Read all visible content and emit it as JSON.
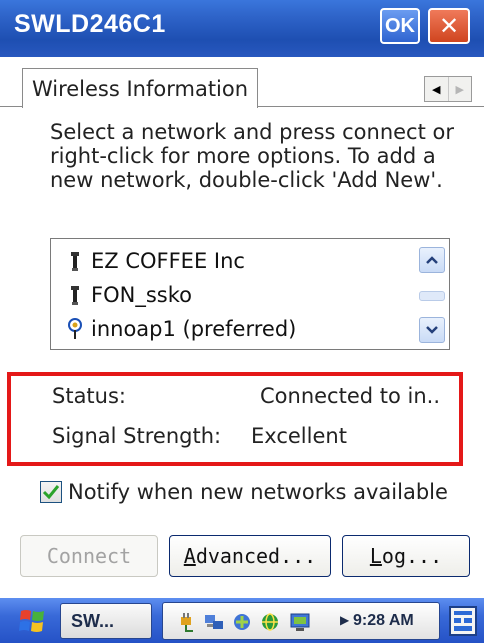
{
  "window": {
    "title": "SWLD246C1",
    "ok_label": "OK",
    "close_label": "✕"
  },
  "tabs": [
    {
      "label": "Wireless Information",
      "selected": true
    }
  ],
  "tab_scroll": {
    "left_icon": "chevron-left-icon",
    "right_icon": "chevron-right-icon"
  },
  "instructions": "Select a network and press connect or right-click for more options.  To add a new network, double-click 'Add New'.",
  "networks": [
    {
      "name": "EZ COFFEE Inc",
      "icon": "wireless-antenna-icon"
    },
    {
      "name": "FON_ssko",
      "icon": "wireless-antenna-icon"
    },
    {
      "name": "innoap1 (preferred)",
      "icon": "preferred-network-icon"
    }
  ],
  "status": {
    "status_label": "Status:",
    "status_value": "Connected to in..",
    "signal_label": "Signal Strength:",
    "signal_value": "Excellent"
  },
  "notify": {
    "label": "Notify when new networks available",
    "checked": true
  },
  "buttons": {
    "connect": {
      "label": "Connect",
      "enabled": false
    },
    "advanced": {
      "label": "Advanced...",
      "mnemonic": "A",
      "rest": "dvanced..."
    },
    "log": {
      "label": "Log...",
      "mnemonic": "L",
      "rest": "og..."
    }
  },
  "taskbar": {
    "task_label": "SW...",
    "time": "9:28 AM",
    "tray_icons": [
      "power-plug-icon",
      "network-computers-icon",
      "connection-icon",
      "globe-icon",
      "display-icon"
    ]
  },
  "colors": {
    "title_bar": "#2e63c8",
    "highlight_box": "#e41818",
    "taskbar": "#3869d8"
  }
}
